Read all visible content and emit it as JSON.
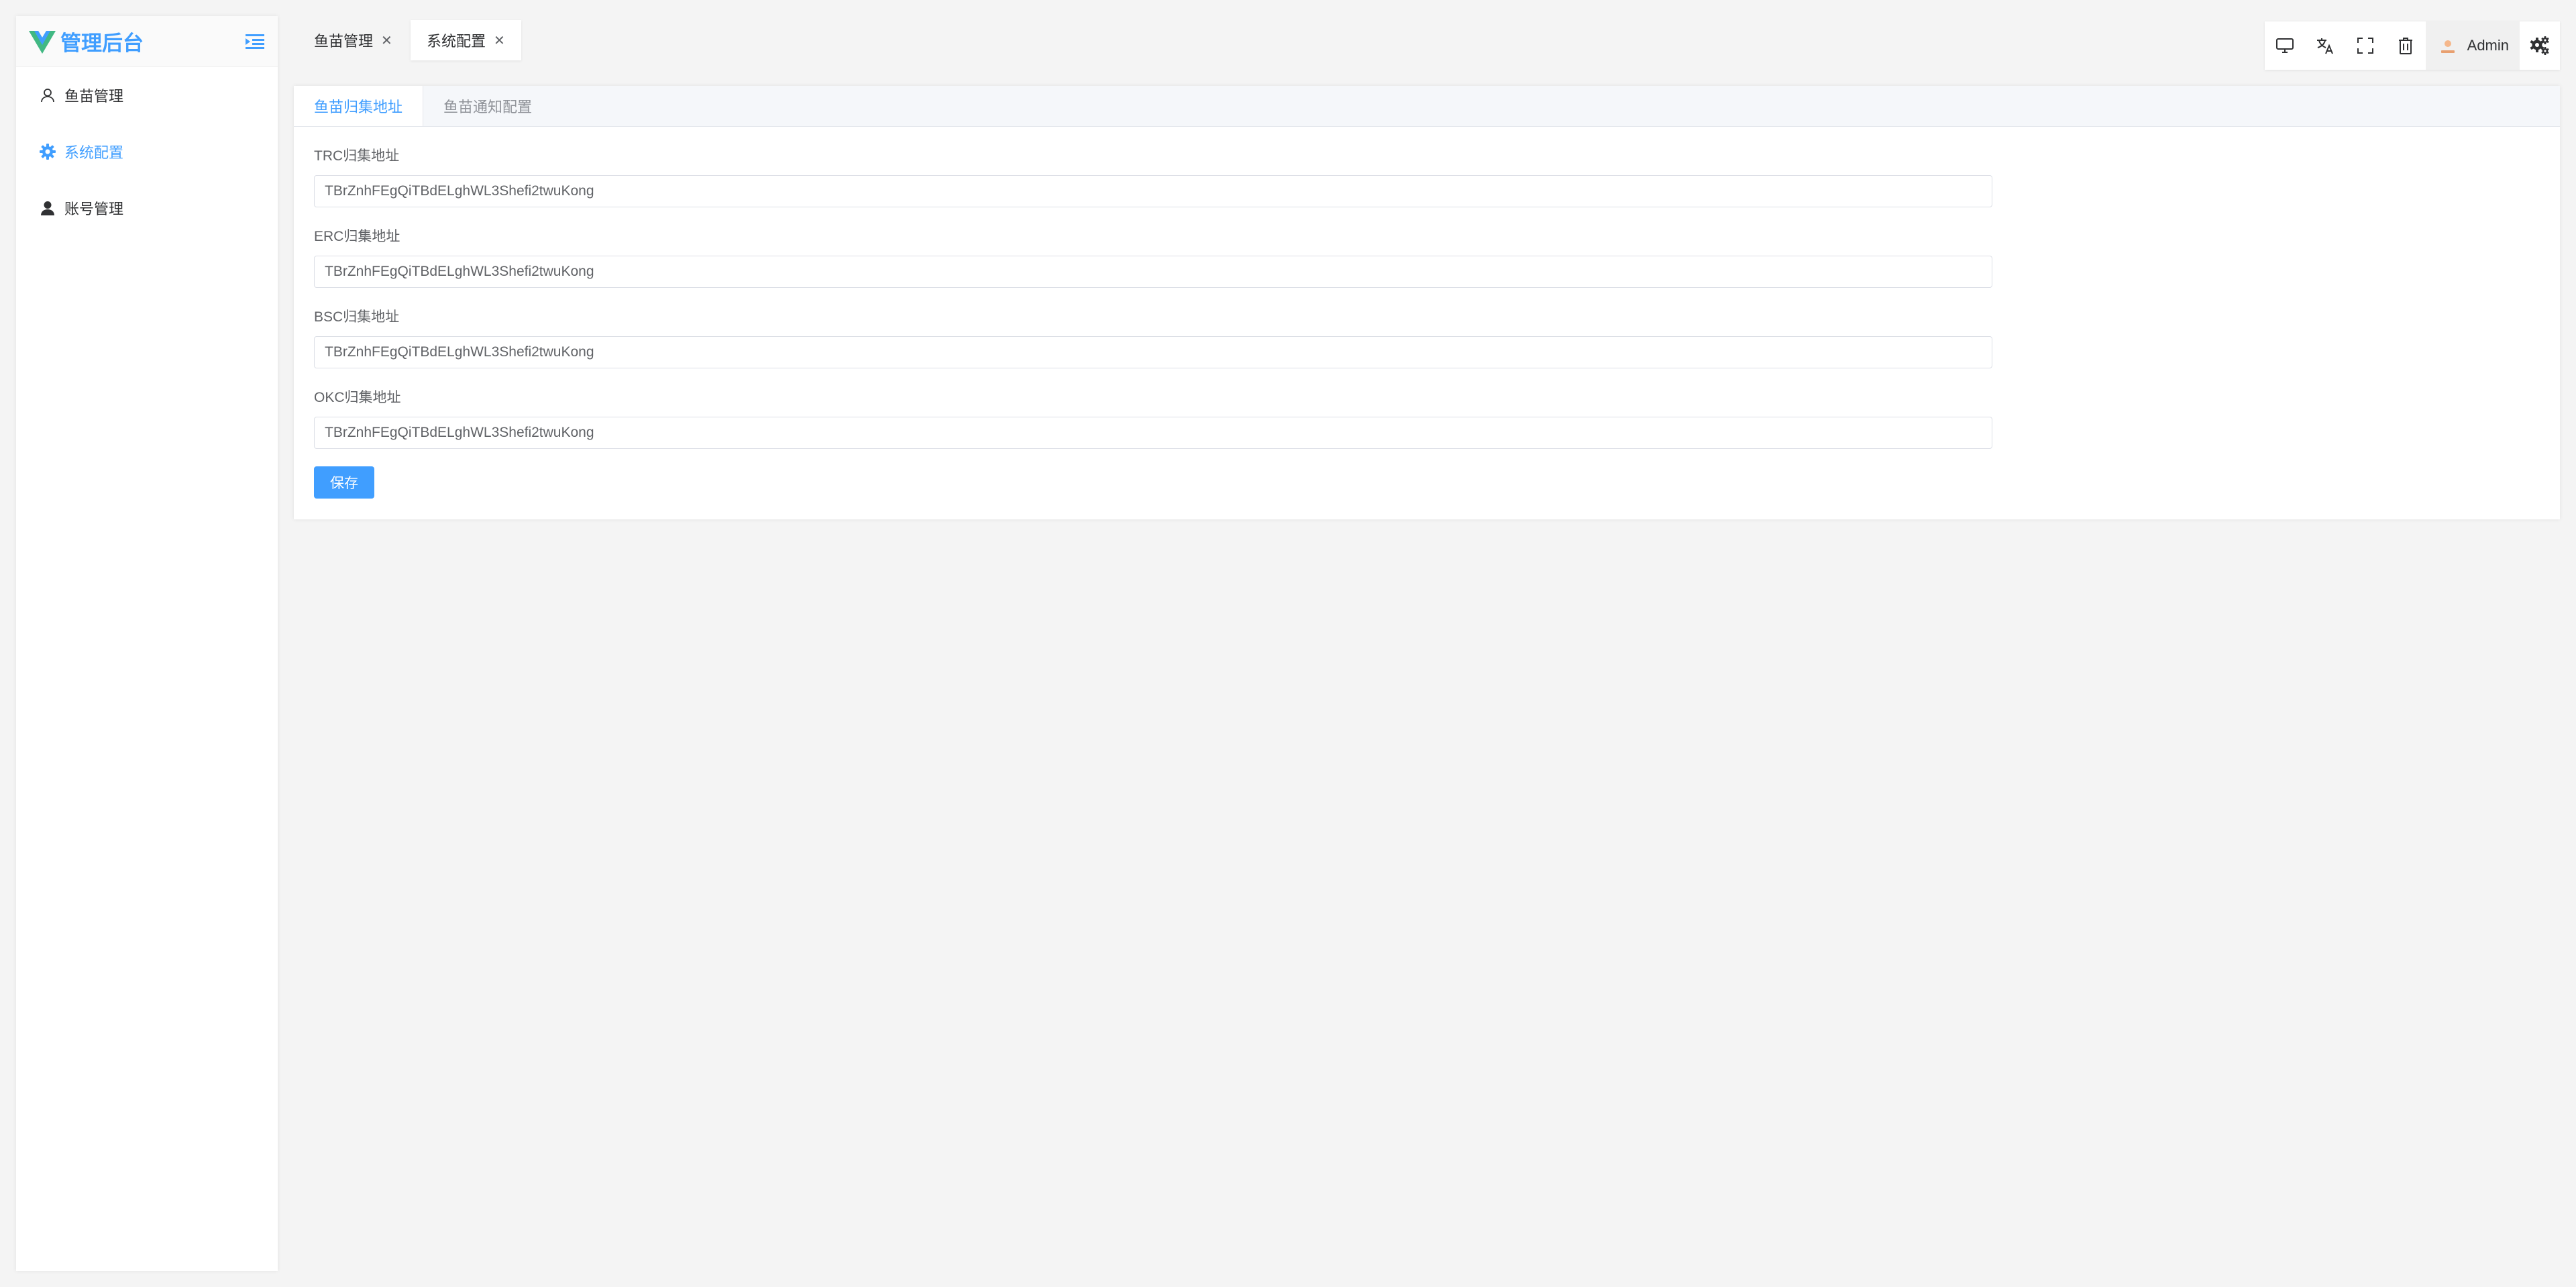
{
  "app": {
    "title": "管理后台"
  },
  "sidebar": {
    "items": [
      {
        "label": "鱼苗管理",
        "icon": "user-outline-icon",
        "active": false
      },
      {
        "label": "系统配置",
        "icon": "gear-icon",
        "active": true
      },
      {
        "label": "账号管理",
        "icon": "user-filled-icon",
        "active": false
      }
    ]
  },
  "tabs": [
    {
      "label": "鱼苗管理",
      "active": false
    },
    {
      "label": "系统配置",
      "active": true
    }
  ],
  "toolbar": {
    "icons": [
      "monitor-icon",
      "translate-icon",
      "fullscreen-icon",
      "trash-icon",
      "settings-icon"
    ],
    "user_name": "Admin"
  },
  "main": {
    "tabs": [
      {
        "label": "鱼苗归集地址",
        "active": true
      },
      {
        "label": "鱼苗通知配置",
        "active": false
      }
    ],
    "fields": [
      {
        "label": "TRC归集地址",
        "value": "TBrZnhFEgQiTBdELghWL3Shefi2twuKong"
      },
      {
        "label": "ERC归集地址",
        "value": "TBrZnhFEgQiTBdELghWL3Shefi2twuKong"
      },
      {
        "label": "BSC归集地址",
        "value": "TBrZnhFEgQiTBdELghWL3Shefi2twuKong"
      },
      {
        "label": "OKC归集地址",
        "value": "TBrZnhFEgQiTBdELghWL3Shefi2twuKong"
      }
    ],
    "save_label": "保存"
  },
  "colors": {
    "accent": "#409eff",
    "background": "#f4f4f4"
  }
}
